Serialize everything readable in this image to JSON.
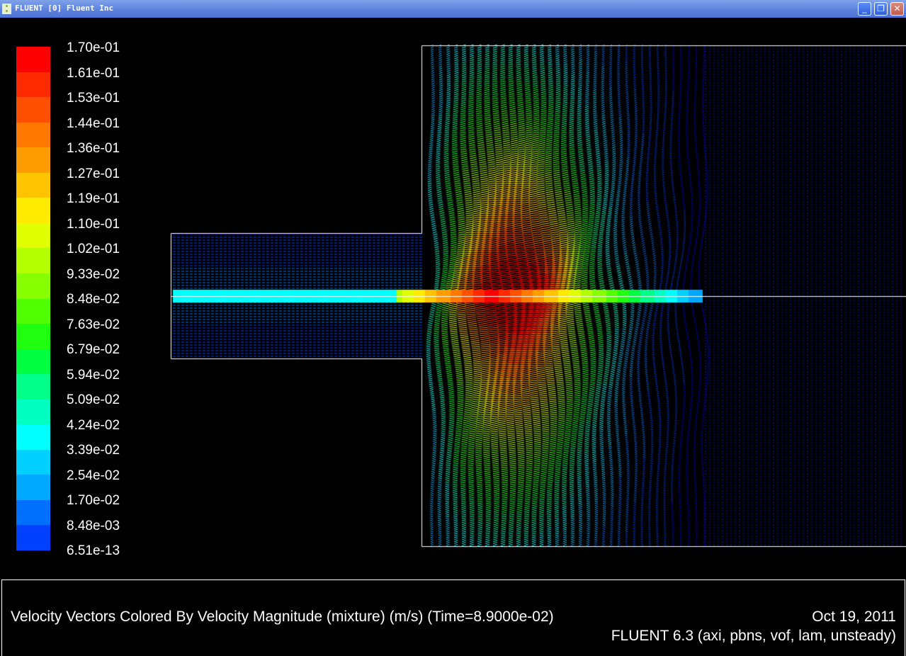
{
  "window": {
    "title": "FLUENT [0] Fluent Inc",
    "buttons": {
      "minimize": "_",
      "restore": "❐",
      "close": "✕"
    }
  },
  "legend": {
    "labels": [
      "1.70e-01",
      "1.61e-01",
      "1.53e-01",
      "1.44e-01",
      "1.36e-01",
      "1.27e-01",
      "1.19e-01",
      "1.10e-01",
      "1.02e-01",
      "9.33e-02",
      "8.48e-02",
      "7.63e-02",
      "6.79e-02",
      "5.94e-02",
      "5.09e-02",
      "4.24e-02",
      "3.39e-02",
      "2.54e-02",
      "1.70e-02",
      "8.48e-03",
      "6.51e-13"
    ],
    "colors": [
      "#ff0000",
      "#ff2a00",
      "#ff5000",
      "#ff7800",
      "#ff9c00",
      "#ffc400",
      "#ffeb00",
      "#e0ff00",
      "#b4ff00",
      "#88ff00",
      "#50ff00",
      "#20ff10",
      "#00ff40",
      "#00ff88",
      "#00ffc0",
      "#00ffff",
      "#00d0ff",
      "#00a8ff",
      "#0070ff",
      "#0040ff",
      "#0000ff"
    ]
  },
  "footer": {
    "description": "Velocity Vectors Colored By Velocity Magnitude (mixture)  (m/s)  (Time=8.9000e-02)",
    "date": "Oct 19, 2011",
    "version": "FLUENT 6.3 (axi, pbns, vof, lam, unsteady)"
  }
}
